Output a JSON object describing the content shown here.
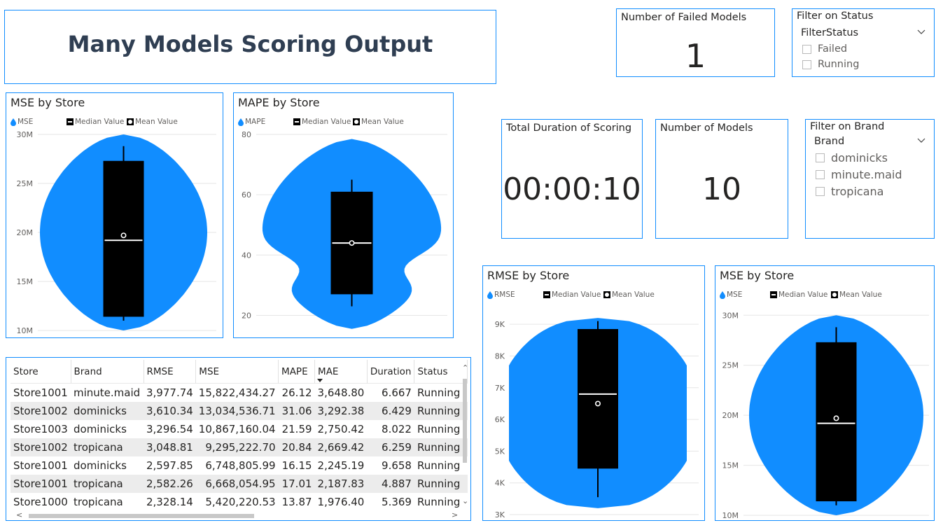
{
  "title": "Many Models Scoring Output",
  "cards": {
    "failed": {
      "title": "Number of Failed Models",
      "value": "1"
    },
    "duration": {
      "title": "Total Duration of Scoring",
      "value": "00:00:10"
    },
    "models": {
      "title": "Number of Models",
      "value": "10"
    }
  },
  "status_filter": {
    "title": "Filter on Status",
    "field": "FilterStatus",
    "options": [
      "Failed",
      "Running"
    ]
  },
  "brand_filter": {
    "title": "Filter on Brand",
    "field": "Brand",
    "options": [
      "dominicks",
      "minute.maid",
      "tropicana"
    ]
  },
  "legend": {
    "median": "Median Value",
    "mean": "Mean Value"
  },
  "colors": {
    "accent": "#118DFF",
    "violin": "#118DFF",
    "box": "#000000",
    "title": "#2f3e52"
  },
  "chart_data": [
    {
      "id": "mse_top",
      "type": "violin",
      "title": "MSE by Store",
      "series": "MSE",
      "ylim": [
        10,
        30
      ],
      "yticks": [
        "10M",
        "15M",
        "20M",
        "25M",
        "30M"
      ],
      "ytick_values": [
        10,
        15,
        20,
        25,
        30
      ],
      "unit": "M",
      "whisker": [
        11.0,
        28.8
      ],
      "box": [
        11.4,
        27.3
      ],
      "median": 19.2,
      "mean": 19.7,
      "violin_range": [
        10.0,
        30.0
      ]
    },
    {
      "id": "mape",
      "type": "violin",
      "title": "MAPE by Store",
      "series": "MAPE",
      "ylim": [
        15,
        80
      ],
      "yticks": [
        "20",
        "40",
        "60",
        "80"
      ],
      "ytick_values": [
        20,
        40,
        60,
        80
      ],
      "whisker": [
        23,
        65
      ],
      "box": [
        27,
        61
      ],
      "median": 44,
      "mean": 44,
      "violin_range": [
        15.5,
        78.5
      ]
    },
    {
      "id": "rmse",
      "type": "violin",
      "title": "RMSE by Store",
      "series": "RMSE",
      "ylim": [
        3,
        9.6
      ],
      "yticks": [
        "3K",
        "4K",
        "5K",
        "6K",
        "7K",
        "8K",
        "9K"
      ],
      "ytick_values": [
        3,
        4,
        5,
        6,
        7,
        8,
        9
      ],
      "unit": "K",
      "whisker": [
        3.55,
        9.1
      ],
      "box": [
        4.45,
        8.85
      ],
      "median": 6.8,
      "mean": 6.5,
      "violin_range": [
        3.2,
        9.2
      ]
    },
    {
      "id": "mse_bottom",
      "type": "violin",
      "title": "MSE by Store",
      "series": "MSE",
      "ylim": [
        10,
        31
      ],
      "yticks": [
        "10M",
        "15M",
        "20M",
        "25M",
        "30M"
      ],
      "ytick_values": [
        10,
        15,
        20,
        25,
        30
      ],
      "unit": "M",
      "whisker": [
        11.0,
        28.8
      ],
      "box": [
        11.4,
        27.3
      ],
      "median": 19.2,
      "mean": 19.7,
      "violin_range": [
        10.0,
        30.0
      ]
    }
  ],
  "table": {
    "columns": [
      "Store",
      "Brand",
      "RMSE",
      "MSE",
      "MAPE",
      "MAE",
      "Duration",
      "Status"
    ],
    "sorted_column": "MAE",
    "rows": [
      [
        "Store1001",
        "minute.maid",
        "3,977.74",
        "15,822,434.27",
        "26.12",
        "3,648.80",
        "6.667",
        "Running"
      ],
      [
        "Store1002",
        "dominicks",
        "3,610.34",
        "13,034,536.71",
        "31.06",
        "3,292.38",
        "6.429",
        "Running"
      ],
      [
        "Store1003",
        "dominicks",
        "3,296.54",
        "10,867,160.04",
        "21.59",
        "2,750.42",
        "8.022",
        "Running"
      ],
      [
        "Store1002",
        "tropicana",
        "3,048.81",
        "9,295,222.70",
        "20.84",
        "2,669.42",
        "6.259",
        "Running"
      ],
      [
        "Store1001",
        "dominicks",
        "2,597.85",
        "6,748,805.99",
        "16.15",
        "2,245.19",
        "9.658",
        "Running"
      ],
      [
        "Store1001",
        "tropicana",
        "2,582.26",
        "6,668,054.95",
        "17.01",
        "2,187.83",
        "4.887",
        "Running"
      ],
      [
        "Store1000",
        "tropicana",
        "2,328.14",
        "5,420,220.53",
        "13.87",
        "1,976.40",
        "5.369",
        "Running"
      ]
    ]
  }
}
